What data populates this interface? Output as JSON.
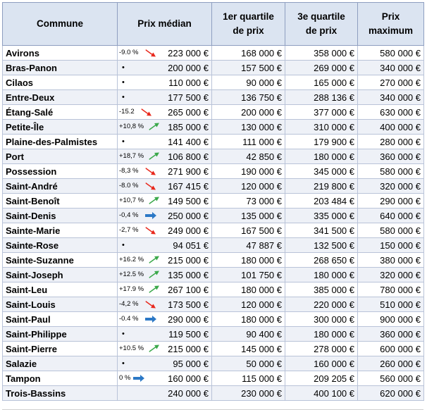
{
  "table": {
    "headers": [
      "Commune",
      "Prix médian",
      "1er quartile\nde prix",
      "3e quartile\nde prix",
      "Prix\nmaximum"
    ],
    "rows": [
      {
        "commune": "Avirons",
        "change": "-9.0 %",
        "trend": "down",
        "median": "223 000 €",
        "q1": "168 000 €",
        "q3": "358 000 €",
        "max": "580 000 €"
      },
      {
        "commune": "Bras-Panon",
        "change": "•",
        "trend": "none",
        "median": "200 000 €",
        "q1": "157 500 €",
        "q3": "269 000 €",
        "max": "340 000 €"
      },
      {
        "commune": "Cilaos",
        "change": "•",
        "trend": "none",
        "median": "110 000 €",
        "q1": "90 000 €",
        "q3": "165 000 €",
        "max": "270 000 €"
      },
      {
        "commune": "Entre-Deux",
        "change": "•",
        "trend": "none",
        "median": "177 500 €",
        "q1": "136 750 €",
        "q3": "288 136 €",
        "max": "340 000 €"
      },
      {
        "commune": "Étang-Salé",
        "change": "-15.2",
        "trend": "down",
        "median": "265 000 €",
        "q1": "200 000 €",
        "q3": "377 000 €",
        "max": "630 000 €"
      },
      {
        "commune": "Petite-Île",
        "change": "+10,8 %",
        "trend": "up",
        "median": "185 000 €",
        "q1": "130 000 €",
        "q3": "310 000 €",
        "max": "400 000 €"
      },
      {
        "commune": "Plaine-des-Palmistes",
        "change": "•",
        "trend": "none",
        "median": "141 400 €",
        "q1": "111 000 €",
        "q3": "179 900 €",
        "max": "280 000 €"
      },
      {
        "commune": "Port",
        "change": "+18,7 %",
        "trend": "up",
        "median": "106 800 €",
        "q1": "42 850 €",
        "q3": "180 000 €",
        "max": "360 000 €"
      },
      {
        "commune": "Possession",
        "change": "-8,3 %",
        "trend": "down",
        "median": "271 900 €",
        "q1": "190 000 €",
        "q3": "345 000 €",
        "max": "580 000 €"
      },
      {
        "commune": "Saint-André",
        "change": "-8.0 %",
        "trend": "down",
        "median": "167 415 €",
        "q1": "120 000 €",
        "q3": "219 800 €",
        "max": "320 000 €"
      },
      {
        "commune": "Saint-Benoît",
        "change": "+10,7 %",
        "trend": "up",
        "median": "149 500 €",
        "q1": "73 000 €",
        "q3": "203 484 €",
        "max": "290 000 €"
      },
      {
        "commune": "Saint-Denis",
        "change": "-0,4 %",
        "trend": "flat",
        "median": "250 000 €",
        "q1": "135 000 €",
        "q3": "335 000 €",
        "max": "640 000 €"
      },
      {
        "commune": "Sainte-Marie",
        "change": "-2,7 %",
        "trend": "down",
        "median": "249 000 €",
        "q1": "167 500 €",
        "q3": "341 500 €",
        "max": "580 000 €"
      },
      {
        "commune": "Sainte-Rose",
        "change": "•",
        "trend": "none",
        "median": "94 051 €",
        "q1": "47 887 €",
        "q3": "132 500 €",
        "max": "150 000 €"
      },
      {
        "commune": "Sainte-Suzanne",
        "change": "+16.2 %",
        "trend": "up",
        "median": "215 000 €",
        "q1": "180 000 €",
        "q3": "268 650 €",
        "max": "380 000 €"
      },
      {
        "commune": "Saint-Joseph",
        "change": "+12.5 %",
        "trend": "up",
        "median": "135 000 €",
        "q1": "101 750 €",
        "q3": "180 000 €",
        "max": "320 000 €"
      },
      {
        "commune": "Saint-Leu",
        "change": "+17.9 %",
        "trend": "up",
        "median": "267 100 €",
        "q1": "180 000 €",
        "q3": "385 000 €",
        "max": "780 000 €"
      },
      {
        "commune": "Saint-Louis",
        "change": "-4,2 %",
        "trend": "down",
        "median": "173 500 €",
        "q1": "120 000 €",
        "q3": "220 000 €",
        "max": "510 000 €"
      },
      {
        "commune": "Saint-Paul",
        "change": "-0.4 %",
        "trend": "flat",
        "median": "290 000 €",
        "q1": "180 000 €",
        "q3": "300 000 €",
        "max": "900 000 €"
      },
      {
        "commune": "Saint-Philippe",
        "change": "•",
        "trend": "none",
        "median": "119 500 €",
        "q1": "90 400 €",
        "q3": "180 000 €",
        "max": "360 000 €"
      },
      {
        "commune": "Saint-Pierre",
        "change": "+10.5 %",
        "trend": "up",
        "median": "215 000 €",
        "q1": "145 000 €",
        "q3": "278 000 €",
        "max": "600 000 €"
      },
      {
        "commune": "Salazie",
        "change": "•",
        "trend": "none",
        "median": "95 000 €",
        "q1": "50 000 €",
        "q3": "160 000 €",
        "max": "260 000 €"
      },
      {
        "commune": "Tampon",
        "change": "0 %",
        "trend": "flat",
        "median": "160 000 €",
        "q1": "115 000 €",
        "q3": "209 205 €",
        "max": "560 000 €"
      },
      {
        "commune": "Trois-Bassins",
        "change": "",
        "trend": "none",
        "median": "240 000 €",
        "q1": "230 000 €",
        "q3": "400 100 €",
        "max": "620 000 €"
      }
    ]
  },
  "colors": {
    "header_bg": "#dbe4f1",
    "row_alt_bg": "#eef1f7",
    "grid_line": "#b9c3d8",
    "trend_down": "#e8281c",
    "trend_up": "#3aa84a",
    "trend_flat": "#2b78c6"
  },
  "icons": {
    "down": "red-down-arrow-icon",
    "up": "green-up-arrow-icon",
    "flat": "blue-right-arrow-icon",
    "none": "bullet-icon"
  }
}
